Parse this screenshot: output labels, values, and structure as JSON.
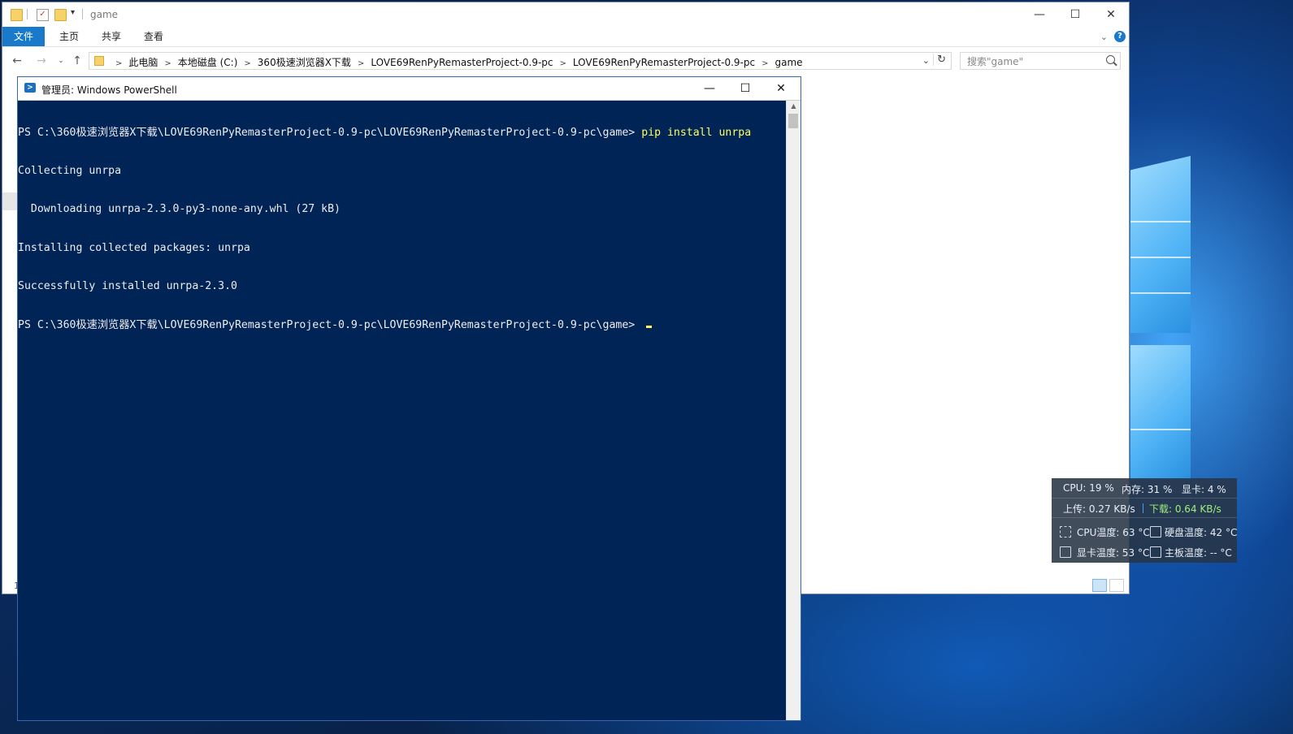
{
  "explorer": {
    "title": "game",
    "ribbon_tabs": [
      "文件",
      "主页",
      "共享",
      "查看"
    ],
    "breadcrumbs": [
      "此电脑",
      "本地磁盘 (C:)",
      "360极速浏览器X下载",
      "LOVE69RenPyRemasterProject-0.9-pc",
      "LOVE69RenPyRemasterProject-0.9-pc",
      "game"
    ],
    "search_placeholder": "搜索\"game\"",
    "status_text": "1",
    "icons": {
      "minimize": "—",
      "maximize": "☐",
      "close": "✕",
      "help": "?"
    }
  },
  "powershell": {
    "title": "管理员: Windows PowerShell",
    "lines": [
      {
        "prompt": "PS C:\\360极速浏览器X下载\\LOVE69RenPyRemasterProject-0.9-pc\\LOVE69RenPyRemasterProject-0.9-pc\\game> ",
        "command": "pip install unrpa"
      },
      {
        "text": "Collecting unrpa"
      },
      {
        "text": "  Downloading unrpa-2.3.0-py3-none-any.whl (27 kB)"
      },
      {
        "text": "Installing collected packages: unrpa"
      },
      {
        "text": "Successfully installed unrpa-2.3.0"
      },
      {
        "prompt": "PS C:\\360极速浏览器X下载\\LOVE69RenPyRemasterProject-0.9-pc\\LOVE69RenPyRemasterProject-0.9-pc\\game> ",
        "command": ""
      }
    ]
  },
  "hwmon": {
    "cpu": "CPU: 19 %",
    "mem": "内存: 31 %",
    "gpu": "显卡: 4 %",
    "upload": "上传: 0.27 KB/s",
    "download": "下载: 0.64 KB/s",
    "cpu_temp": "CPU温度: 63 °C",
    "disk_temp": "硬盘温度: 42 °C",
    "gpu_temp": "显卡温度: 53 °C",
    "board_temp": "主板温度: -- °C"
  },
  "colors": {
    "ps_background": "#012456",
    "ribbon_active": "#1979ca",
    "download_green": "#9ef07a"
  }
}
